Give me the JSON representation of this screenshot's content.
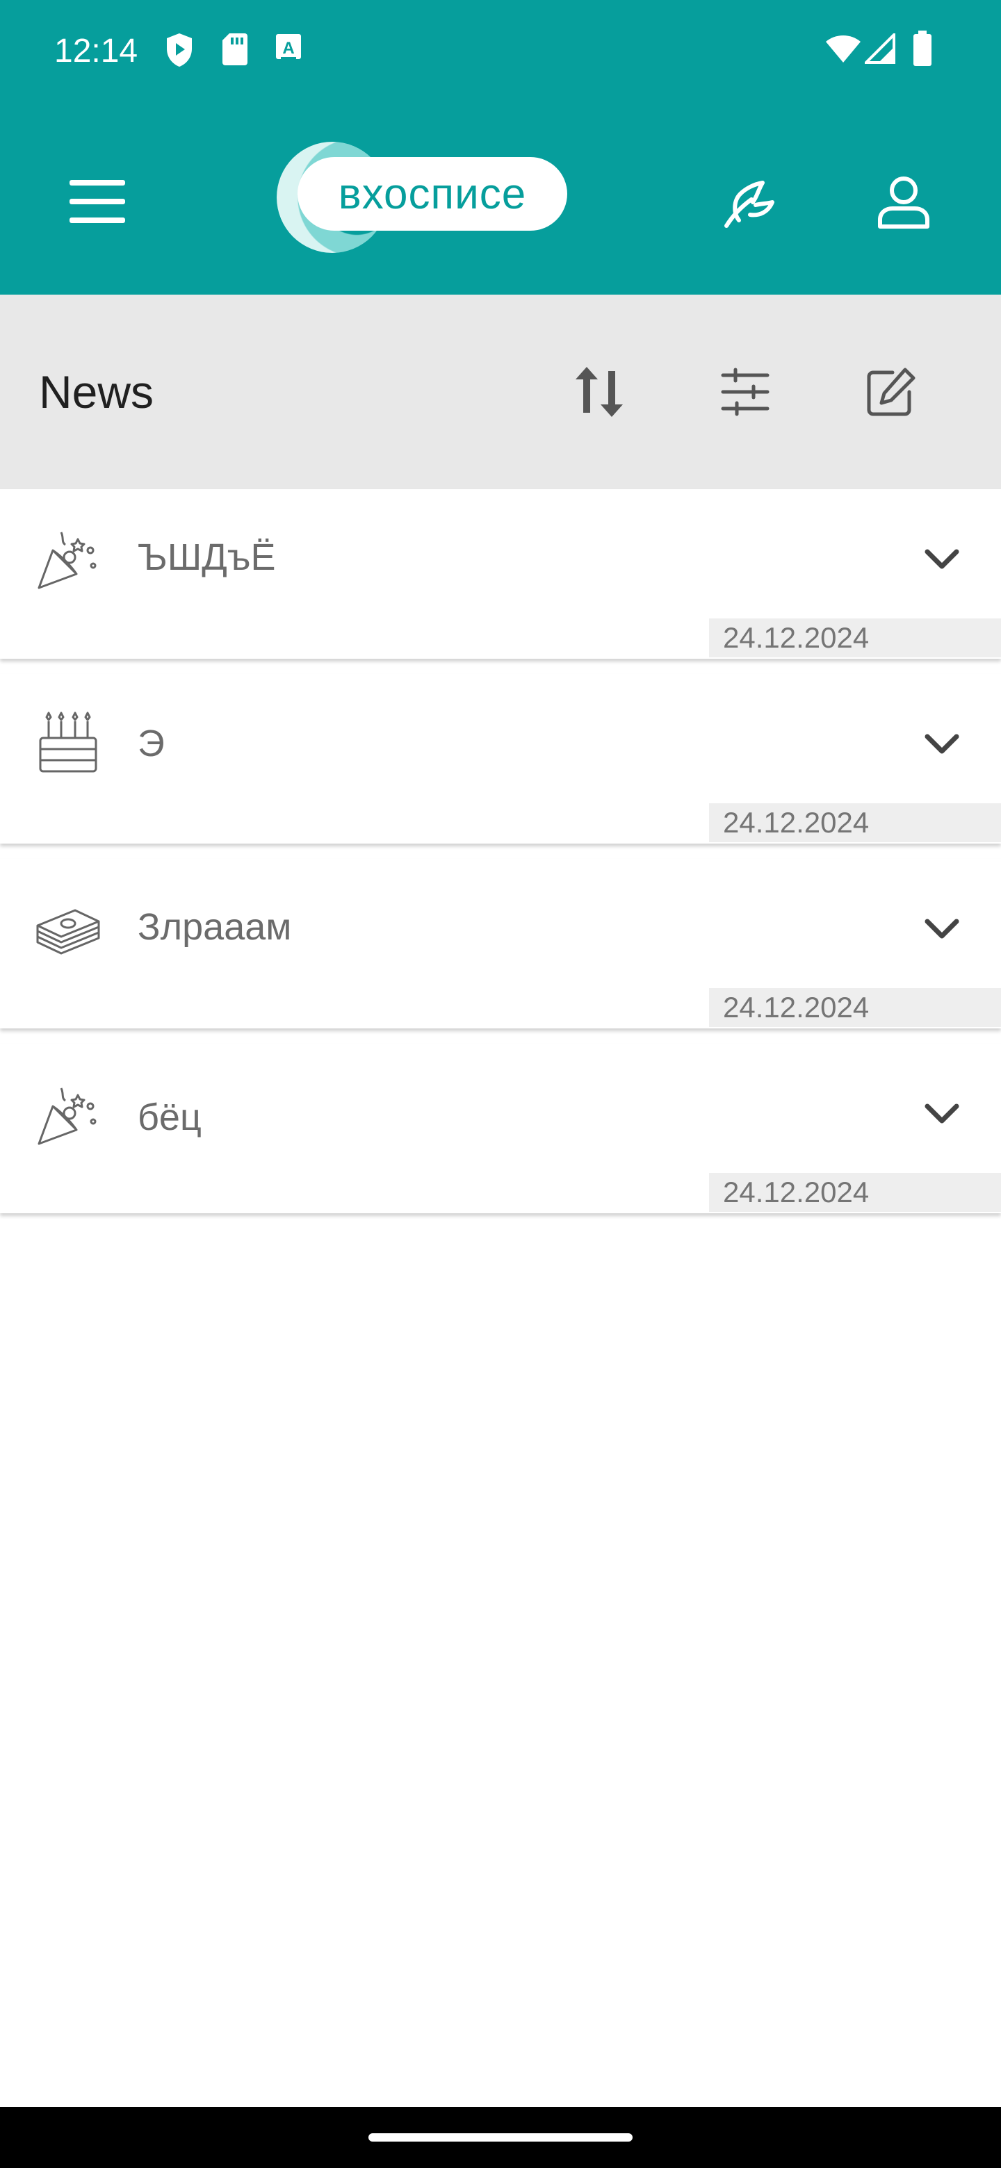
{
  "status_bar": {
    "time": "12:14",
    "left_icons": [
      "shield-play-icon",
      "sd-card-icon",
      "a-badge-icon"
    ],
    "right_icons": [
      "wifi-icon",
      "cell-signal-icon",
      "battery-icon"
    ]
  },
  "app_bar": {
    "logo_text": "вхосписе",
    "icons": [
      "menu-icon",
      "feather-icon",
      "profile-icon"
    ]
  },
  "section": {
    "title": "News",
    "actions": [
      "sort-icon",
      "filter-sliders-icon",
      "edit-icon"
    ]
  },
  "news": [
    {
      "icon": "party-popper-icon",
      "title": "ЪШДъЁ",
      "date": "24.12.2024"
    },
    {
      "icon": "birthday-cake-icon",
      "title": "Э",
      "date": "24.12.2024"
    },
    {
      "icon": "money-stack-icon",
      "title": "Злрааам",
      "date": "24.12.2024"
    },
    {
      "icon": "party-popper-icon",
      "title": "бёц",
      "date": "24.12.2024"
    }
  ],
  "colors": {
    "primary": "#069e9c",
    "section_bg": "#e8e8e8",
    "date_bg": "#eeeeee",
    "text_muted": "#6b6b6b"
  }
}
